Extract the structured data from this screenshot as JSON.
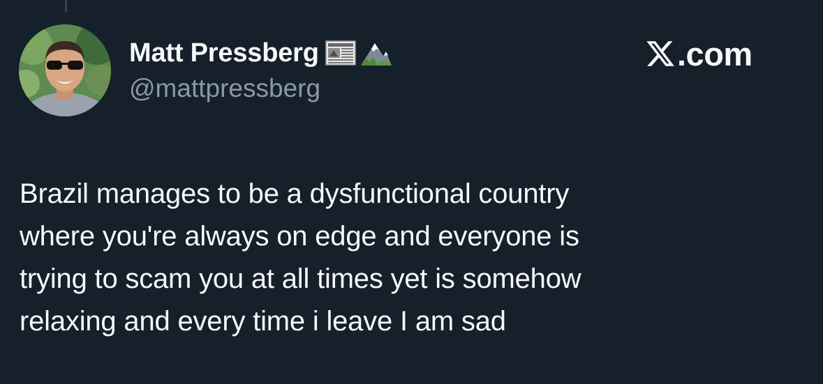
{
  "tweet": {
    "author": {
      "display_name": "Matt Pressberg",
      "handle": "@mattpressberg",
      "badges": [
        "newspaper-emoji",
        "mountain-emoji"
      ],
      "avatar": "profile-photo"
    },
    "brand": {
      "icon": "x-logo-icon",
      "text": ".com"
    },
    "text": "Brazil manages to be a dysfunctional country\nwhere you're always on edge and everyone is\ntrying to scam you at all times yet is somehow\nrelaxing and every time i leave I am sad"
  },
  "colors": {
    "background": "#15202b",
    "text_primary": "#f7f9f9",
    "text_secondary": "#8b98a5",
    "thread_line": "#38444d"
  }
}
